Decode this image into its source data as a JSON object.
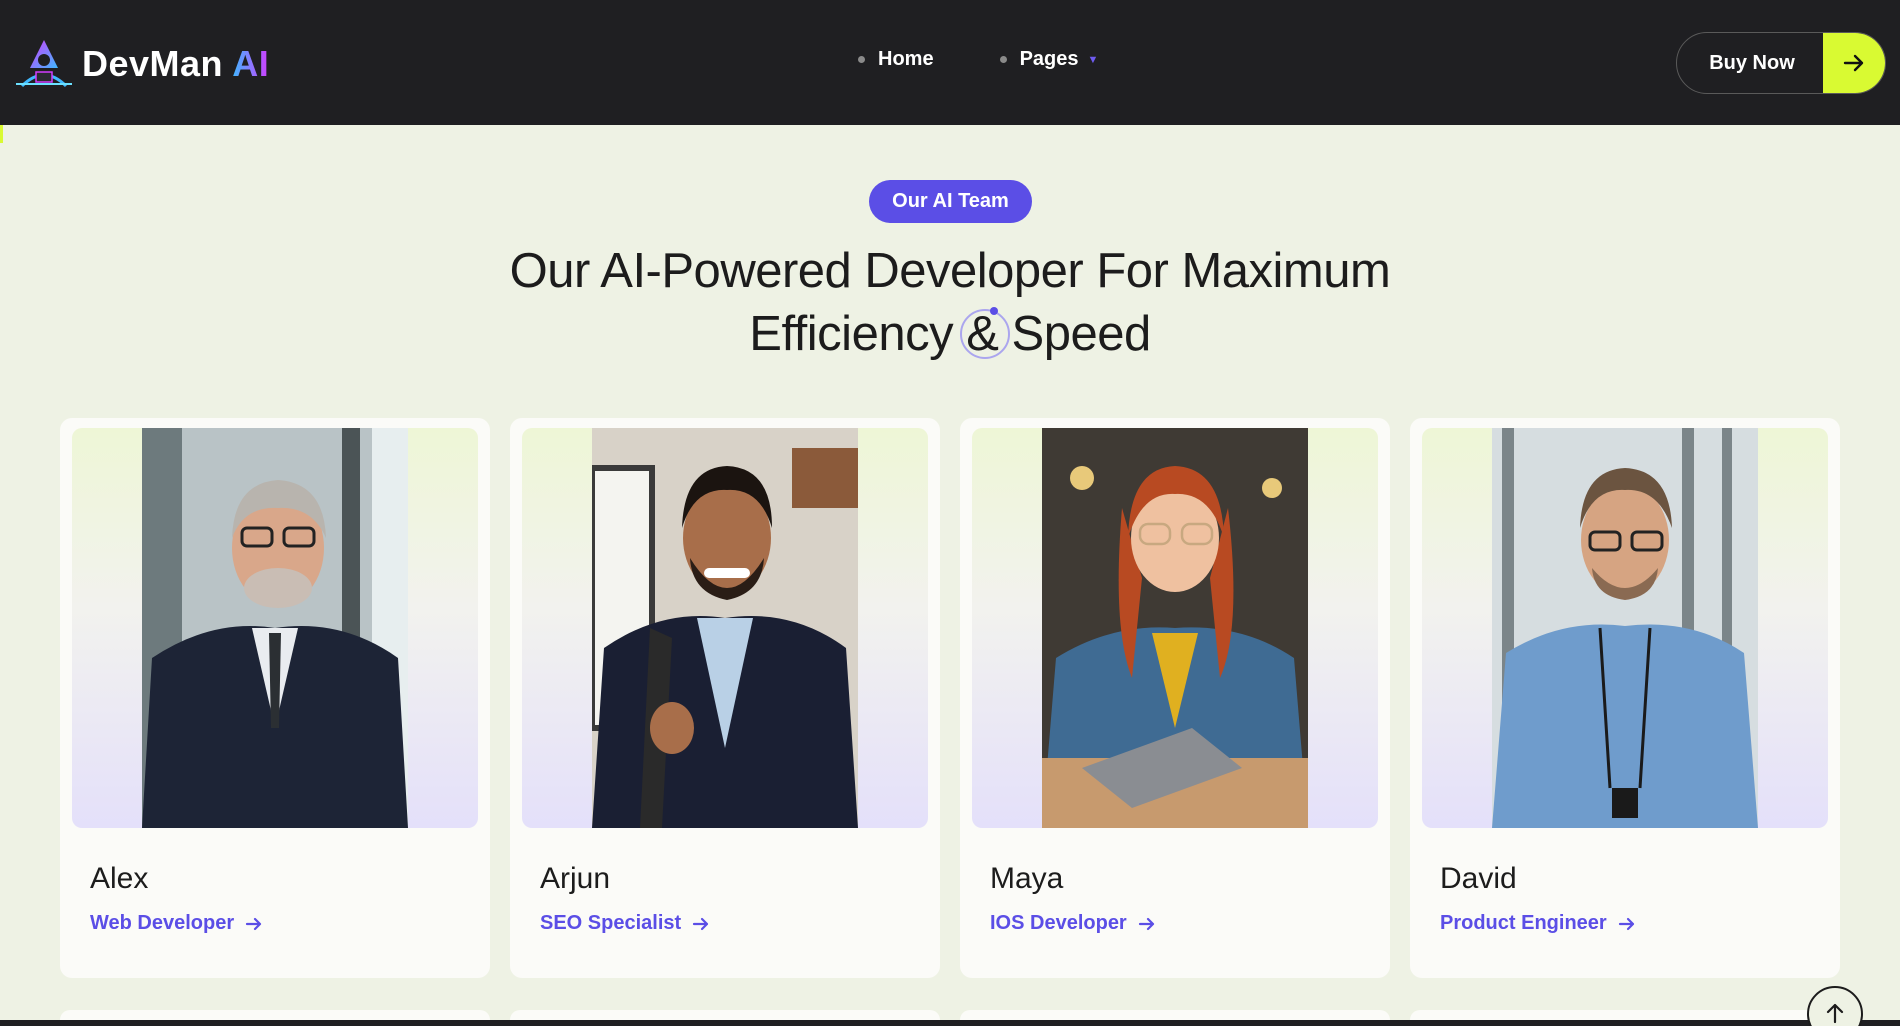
{
  "header": {
    "logo": {
      "name": "DevMan",
      "accent": "AI",
      "icon": "hooded-hacker-logo"
    },
    "nav": [
      {
        "label": "Home",
        "has_dropdown": false
      },
      {
        "label": "Pages",
        "has_dropdown": true
      }
    ],
    "buy_label": "Buy Now"
  },
  "hero": {
    "badge": "Our AI Team",
    "title_line1": "Our AI-Powered Developer For Maximum",
    "title_line2_a": "Efficiency",
    "title_line2_amp": "&",
    "title_line2_b": "Speed"
  },
  "team": [
    {
      "name": "Alex",
      "role": "Web Developer",
      "photo": "man-gray-hair-navy-suit-glasses"
    },
    {
      "name": "Arjun",
      "role": "SEO Specialist",
      "photo": "smiling-man-beard-blazer-backpack"
    },
    {
      "name": "Maya",
      "role": "IOS Developer",
      "photo": "redhead-woman-denim-jacket-laptop"
    },
    {
      "name": "David",
      "role": "Product Engineer",
      "photo": "man-blue-shirt-lanyard-glasses"
    }
  ],
  "colors": {
    "page_bg": "#eef2e4",
    "header_bg": "#1f1f22",
    "accent_purple": "#5b4ee6",
    "accent_lime": "#d9fa32"
  }
}
